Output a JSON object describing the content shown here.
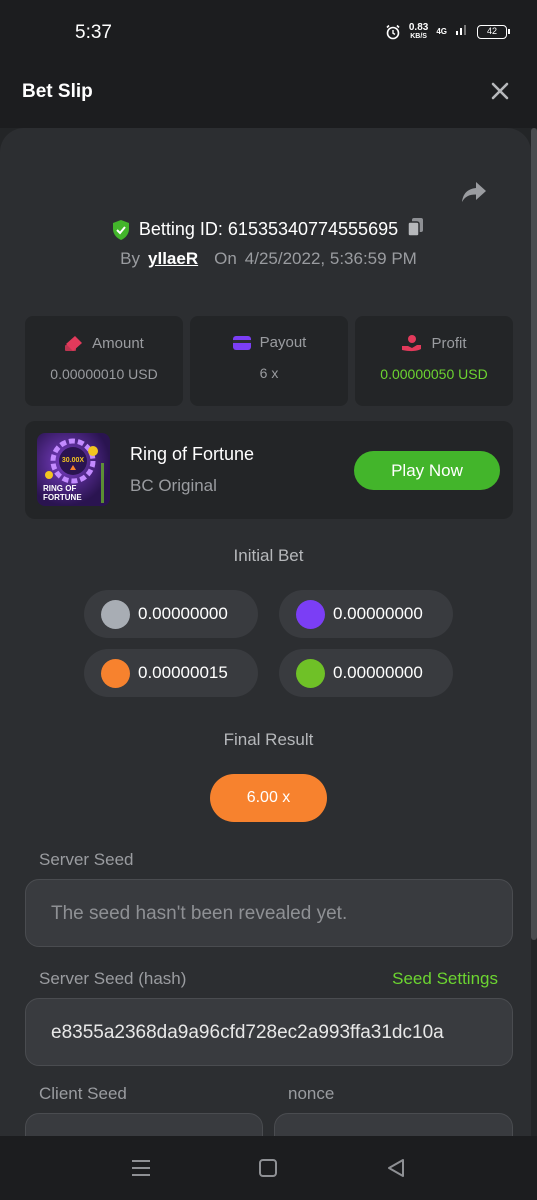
{
  "status_bar": {
    "time": "5:37",
    "speed_value": "0.83",
    "speed_unit": "KB/S",
    "network": "4G",
    "battery": "42"
  },
  "header": {
    "title": "Bet Slip"
  },
  "bet_info": {
    "betting_id_label": "Betting ID: 61535340774555695",
    "by_label": "By",
    "username": "yllaeR",
    "on_label": "On",
    "datetime": "4/25/2022, 5:36:59 PM"
  },
  "stats": [
    {
      "label": "Amount",
      "value": "0.00000010 USD",
      "icon": "money-stack-icon"
    },
    {
      "label": "Payout",
      "value": "6 x",
      "icon": "card-icon"
    },
    {
      "label": "Profit",
      "value": "0.00000050 USD",
      "icon": "hand-coin-icon"
    }
  ],
  "game": {
    "name": "Ring of Fortune",
    "subtitle": "BC Original",
    "play_label": "Play Now",
    "thumb_text_top": "30.00X",
    "thumb_text_bottom_1": "RING OF",
    "thumb_text_bottom_2": "FORTUNE"
  },
  "initial_bet": {
    "title": "Initial Bet",
    "chips": [
      {
        "value": "0.00000000",
        "color": "#a8adb4"
      },
      {
        "value": "0.00000000",
        "color": "#7b3ef5"
      },
      {
        "value": "0.00000015",
        "color": "#f7822e"
      },
      {
        "value": "0.00000000",
        "color": "#6fc127"
      }
    ]
  },
  "final_result": {
    "title": "Final Result",
    "value": "6.00 x"
  },
  "seeds": {
    "server_seed_label": "Server Seed",
    "server_seed_value": "The seed hasn't been revealed yet.",
    "server_seed_hash_label": "Server Seed (hash)",
    "seed_settings_label": "Seed Settings",
    "server_seed_hash_value": "e8355a2368da9a96cfd728ec2a993ffa31dc10a",
    "client_seed_label": "Client Seed",
    "nonce_label": "nonce"
  },
  "colors": {
    "accent_green": "#6cd431",
    "play_green": "#43b52b",
    "orange": "#f7822e"
  }
}
